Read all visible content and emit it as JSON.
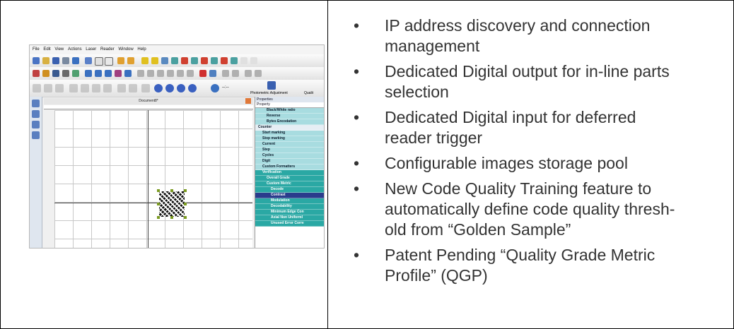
{
  "software_screenshot": {
    "menus": [
      "File",
      "Edit",
      "View",
      "Actions",
      "Laser",
      "Reader",
      "Window",
      "Help"
    ],
    "toolbar_label": "Photometric Adjustment",
    "toolbar_label_2": "Qualit",
    "toolbar_value": "--:--",
    "document_title": "Document8*",
    "properties_title": "Properties",
    "property_header": "Property",
    "properties": [
      {
        "label": "Black/White ratio",
        "style": "l2"
      },
      {
        "label": "Reverse",
        "style": "l2"
      },
      {
        "label": "Bytes Encodation",
        "style": "l2"
      },
      {
        "label": "Counter",
        "style": "l0"
      },
      {
        "label": "Start marking",
        "style": "l1"
      },
      {
        "label": "Stop marking",
        "style": "l1"
      },
      {
        "label": "Current",
        "style": "l1"
      },
      {
        "label": "Step",
        "style": "l1"
      },
      {
        "label": "Cycles",
        "style": "l1"
      },
      {
        "label": "Digit",
        "style": "l1"
      },
      {
        "label": "Custom Formatters",
        "style": "l1"
      },
      {
        "label": "Verification",
        "style": "t1"
      },
      {
        "label": "Overall Grade",
        "style": "t2"
      },
      {
        "label": "Custom Metric",
        "style": "t2"
      },
      {
        "label": "Decode",
        "style": "t3"
      },
      {
        "label": "Contrast",
        "style": "sel"
      },
      {
        "label": "Modulation",
        "style": "t3"
      },
      {
        "label": "Decodability",
        "style": "t3"
      },
      {
        "label": "Minimum Edge Con",
        "style": "t3"
      },
      {
        "label": "Axial Non Uniforml",
        "style": "t3"
      },
      {
        "label": "Unused Error Corre",
        "style": "t3"
      }
    ]
  },
  "features": [
    {
      "bullet": "•",
      "lines": [
        "IP address discovery and connection",
        "management"
      ]
    },
    {
      "bullet": "•",
      "lines": [
        "Dedicated Digital output for in-line parts",
        "selection"
      ]
    },
    {
      "bullet": "•",
      "lines": [
        "Dedicated Digital input for deferred",
        "reader trigger"
      ]
    },
    {
      "bullet": "•",
      "lines": [
        "Configurable images storage pool"
      ]
    },
    {
      "bullet": "•",
      "lines": [
        "New Code Quality Training feature to",
        "automatically define code quality thresh-",
        "old from “Golden Sample”"
      ]
    },
    {
      "bullet": "•",
      "lines": [
        "Patent Pending “Quality Grade Metric",
        "Profile” (QGP)"
      ]
    }
  ]
}
